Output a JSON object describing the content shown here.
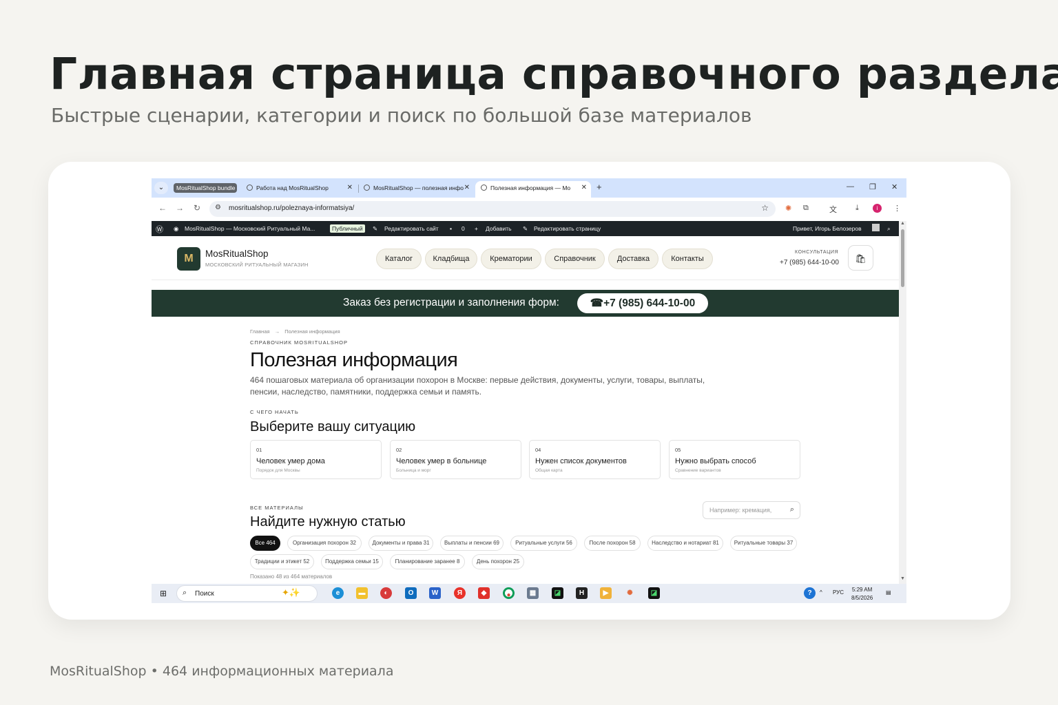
{
  "slide": {
    "title": "Главная страница справочного раздела",
    "subtitle": "Быстрые сценарии, категории и поиск по большой базе материалов",
    "footer": "MosRitualShop • 464 информационных материала"
  },
  "browser": {
    "tab_group": "MosRitualShop bundle",
    "tabs": [
      {
        "label": "Работа над MosRitualShop"
      },
      {
        "label": "MosRitualShop — полезная инфо"
      },
      {
        "label": "Полезная информация — Mo"
      }
    ],
    "new_tab": "+",
    "url": "mosritualshop.ru/poleznaya-informatsiya/",
    "profile_initial": "i"
  },
  "wp_admin": {
    "site_name": "MosRitualShop — Московский Ритуальный Ма...",
    "public_badge": "Публичный",
    "edit_site": "Редактировать сайт",
    "comments": "0",
    "add_new": "Добавить",
    "edit_page": "Редактировать страницу",
    "greeting": "Привет, Игорь Белозеров"
  },
  "site": {
    "logo_letter": "M",
    "brand": "MosRitualShop",
    "brand_sub": "МОСКОВСКИЙ РИТУАЛЬНЫЙ МАГАЗИН",
    "nav": [
      "Каталог",
      "Кладбища",
      "Крематории",
      "Справочник",
      "Доставка",
      "Контакты"
    ],
    "consult_label": "КОНСУЛЬТАЦИЯ",
    "consult_phone": "+7 (985) 644-10-00",
    "banner_text": "Заказ без регистрации и заполнения форм:",
    "banner_phone": "☎+7 (985) 644-10-00"
  },
  "page": {
    "breadcrumb": [
      "Главная",
      "→",
      "Полезная информация"
    ],
    "eyebrow": "СПРАВОЧНИК MOSRITUALSHOP",
    "title": "Полезная информация",
    "lead": "464 пошаговых материала об организации похорон в Москве: первые действия, документы, услуги, товары, выплаты, пенсии, наследство, памятники, поддержка семьи и память.",
    "start_eyebrow": "С ЧЕГО НАЧАТЬ",
    "start_title": "Выберите вашу ситуацию",
    "situations": [
      {
        "num": "01",
        "title": "Человек умер дома",
        "sub": "Порядок для Москвы"
      },
      {
        "num": "02",
        "title": "Человек умер в больнице",
        "sub": "Больница и морг"
      },
      {
        "num": "04",
        "title": "Нужен список документов",
        "sub": "Общая карта"
      },
      {
        "num": "05",
        "title": "Нужно выбрать способ",
        "sub": "Сравнение вариантов"
      }
    ],
    "all_eyebrow": "ВСЕ МАТЕРИАЛЫ",
    "all_title": "Найдите нужную статью",
    "search_placeholder": "Например: кремация,",
    "chips": [
      "Все 464",
      "Организация похорон 32",
      "Документы и права 31",
      "Выплаты и пенсии 69",
      "Ритуальные услуги 56",
      "После похорон 58",
      "Наследство и нотариат 81",
      "Ритуальные товары 37",
      "Традиции и этикет 52",
      "Поддержка семьи 15",
      "Планирование заранее 8",
      "День похорон 25"
    ],
    "shown": "Показано 48 из 464 материалов"
  },
  "taskbar": {
    "search": "Поиск",
    "lang": "РУС",
    "time": "5:29 AM",
    "date": "8/5/2026"
  }
}
